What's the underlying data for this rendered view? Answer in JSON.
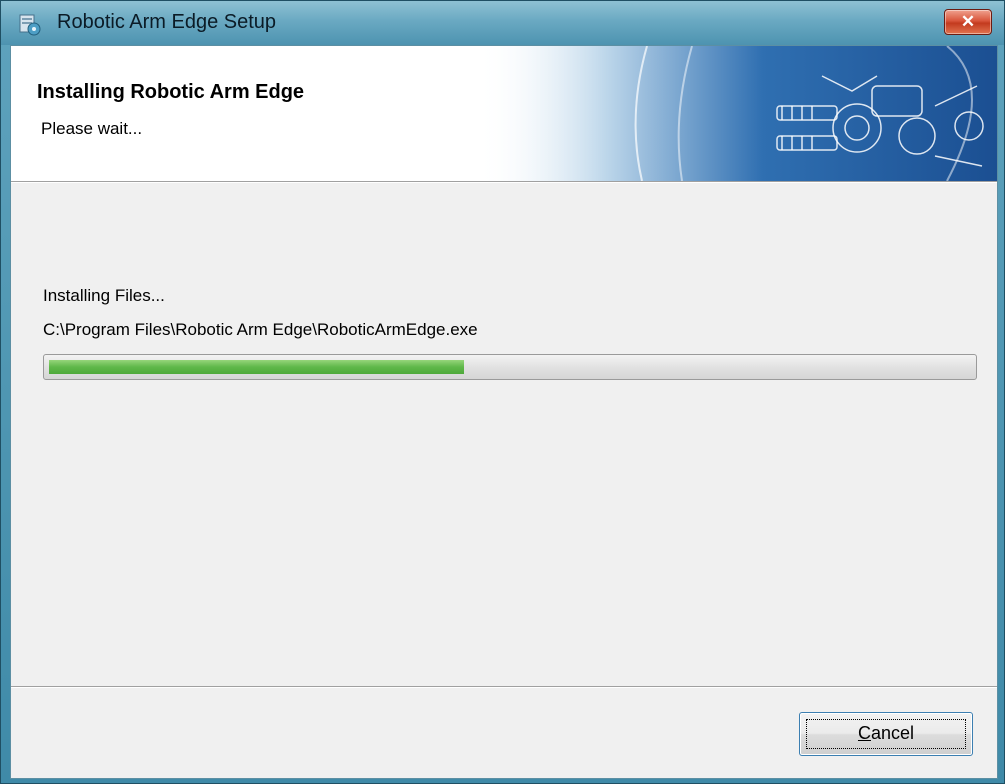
{
  "window": {
    "title": "Robotic Arm Edge Setup",
    "close_label": "✕"
  },
  "header": {
    "title": "Installing Robotic Arm Edge",
    "subtitle": "Please wait..."
  },
  "body": {
    "status_label": "Installing Files...",
    "current_file": "C:\\Program Files\\Robotic Arm Edge\\RoboticArmEdge.exe",
    "progress_fraction": 0.45
  },
  "footer": {
    "cancel_mnemonic": "C",
    "cancel_rest": "ancel"
  },
  "colors": {
    "progress_green": "#5fb84a",
    "title_bar": "#6aa9c2",
    "close_red": "#c33a1f"
  },
  "icons": [
    "installer-icon",
    "close-icon",
    "robotic-arm-banner"
  ]
}
